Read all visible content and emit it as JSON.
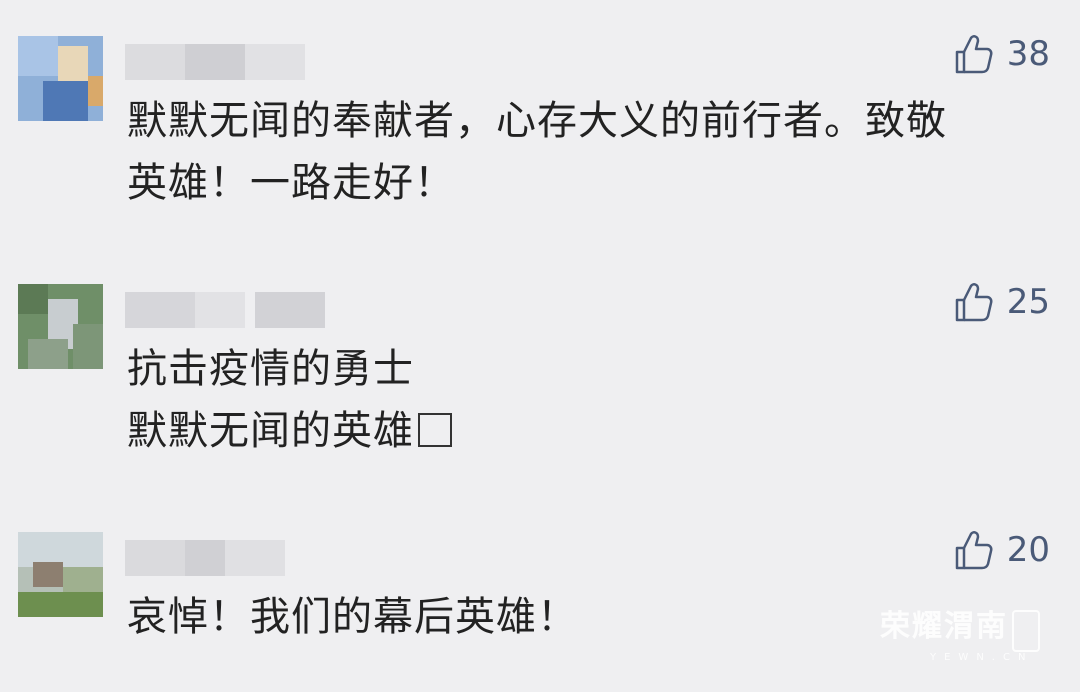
{
  "comments": [
    {
      "like_count": "38",
      "text_lines": [
        "默默无闻的奉献者，心存大义的前行者。致敬",
        "英雄！一路走好！"
      ]
    },
    {
      "like_count": "25",
      "text_lines": [
        "抗击疫情的勇士",
        "默默无闻的英雄"
      ]
    },
    {
      "like_count": "20",
      "text_lines": [
        "哀悼！我们的幕后英雄！"
      ]
    }
  ],
  "icons": {
    "like": "thumbs-up-icon"
  },
  "watermark": {
    "title": "荣耀渭南",
    "domain": "YEWN.CN"
  },
  "colors": {
    "background": "#efeff1",
    "like_icon": "#4a5a78",
    "text": "#222222"
  }
}
